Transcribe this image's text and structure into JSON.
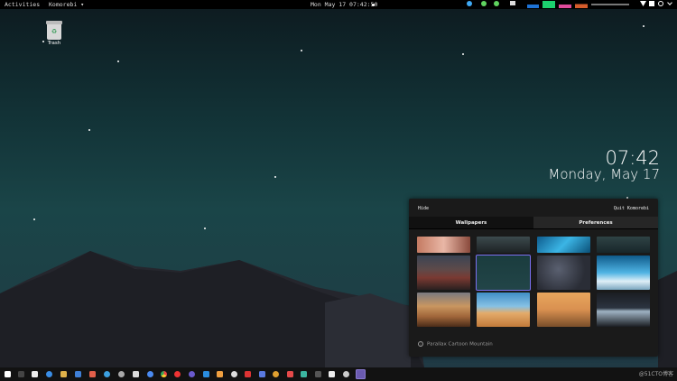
{
  "topbar": {
    "activities": "Activities",
    "app_menu": "Komorebi ▾",
    "clock": "Mon May 17  07:42:50"
  },
  "desktop": {
    "trash_label": "Trash",
    "clock_time": "07:42",
    "clock_date": "Monday, May 17"
  },
  "panel": {
    "hide_label": "Hide",
    "quit_label": "Quit Komorebi",
    "tabs": [
      "Wallpapers",
      "Preferences"
    ],
    "active_tab": "Wallpapers",
    "selected_wallpaper": "Parallax Cartoon Mountain",
    "info_icon": "info-icon"
  },
  "watermark": "@51CTO博客",
  "colors": {
    "accent": "#7a6ff0",
    "panel_bg": "#1a1a1a",
    "topbar_bg": "#000000"
  }
}
